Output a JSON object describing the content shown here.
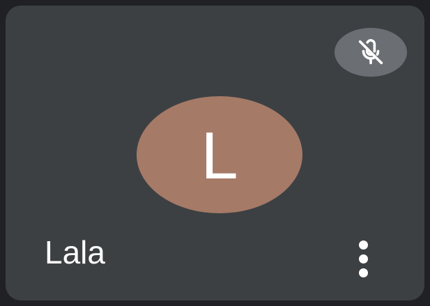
{
  "participant": {
    "name": "Lala",
    "initial": "L",
    "avatar_color": "#a57a67",
    "muted": true
  },
  "icons": {
    "mute": "mic-off-icon",
    "more": "more-vert-icon"
  },
  "colors": {
    "tile_background": "#3c4043",
    "badge_background": "#6b6e72",
    "text": "#ffffff"
  }
}
